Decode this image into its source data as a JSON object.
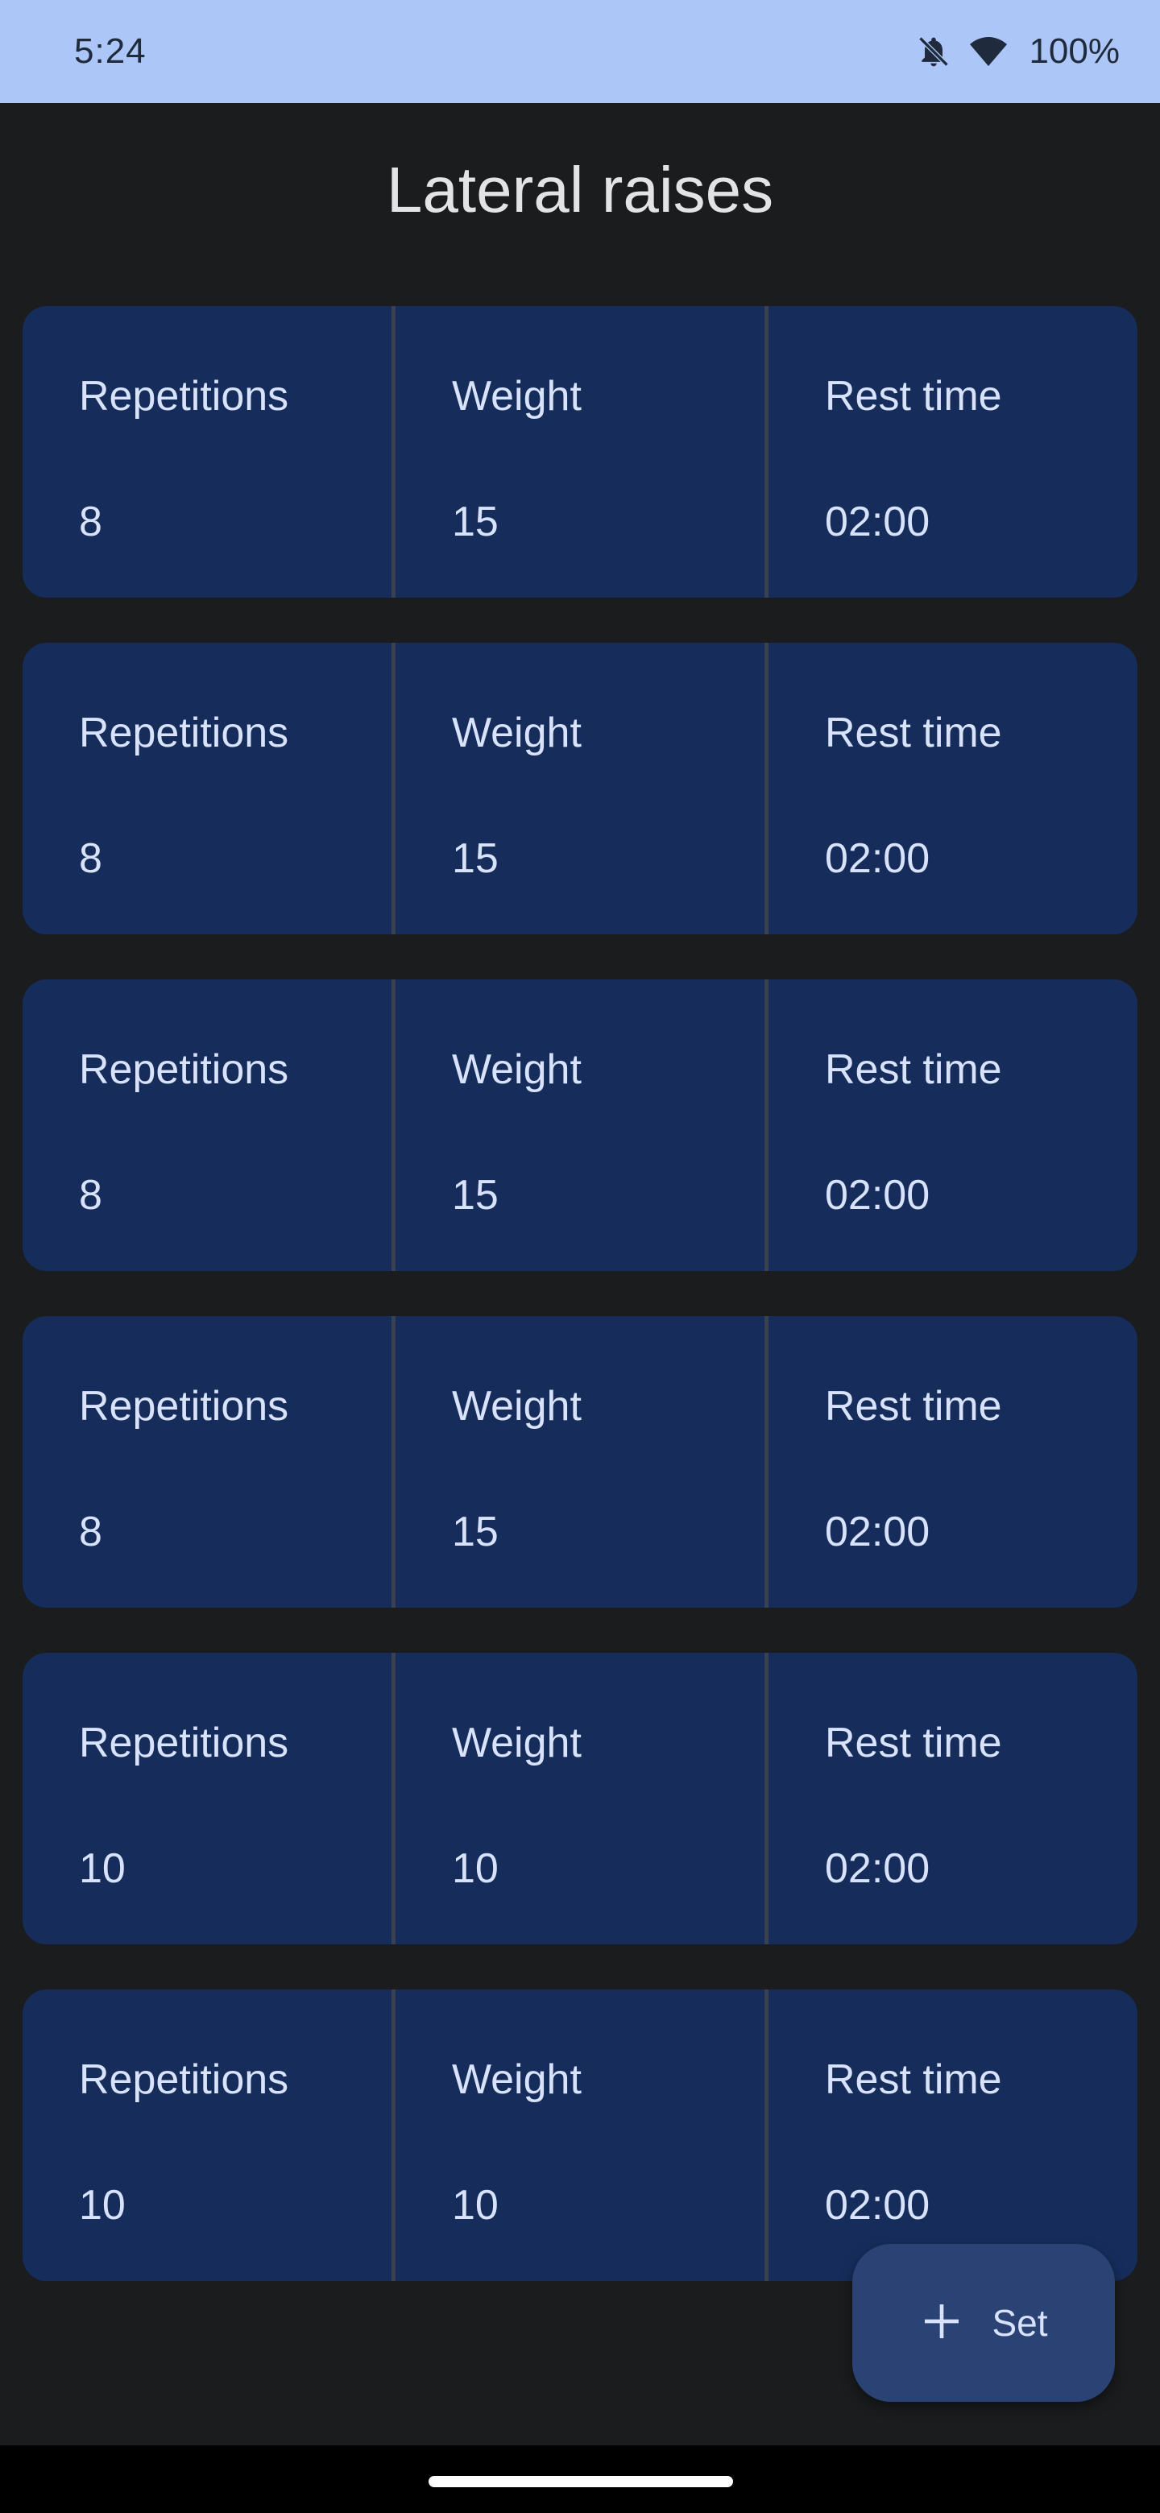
{
  "status_bar": {
    "time": "5:24",
    "battery": "100%",
    "icons": [
      "notifications-off-icon",
      "wifi-icon"
    ]
  },
  "screen": {
    "title": "Lateral raises"
  },
  "sets": [
    {
      "reps_label": "Repetitions",
      "reps": "8",
      "weight_label": "Weight",
      "weight": "15",
      "rest_label": "Rest time",
      "rest": "02:00"
    },
    {
      "reps_label": "Repetitions",
      "reps": "8",
      "weight_label": "Weight",
      "weight": "15",
      "rest_label": "Rest time",
      "rest": "02:00"
    },
    {
      "reps_label": "Repetitions",
      "reps": "8",
      "weight_label": "Weight",
      "weight": "15",
      "rest_label": "Rest time",
      "rest": "02:00"
    },
    {
      "reps_label": "Repetitions",
      "reps": "8",
      "weight_label": "Weight",
      "weight": "15",
      "rest_label": "Rest time",
      "rest": "02:00"
    },
    {
      "reps_label": "Repetitions",
      "reps": "10",
      "weight_label": "Weight",
      "weight": "10",
      "rest_label": "Rest time",
      "rest": "02:00"
    },
    {
      "reps_label": "Repetitions",
      "reps": "10",
      "weight_label": "Weight",
      "weight": "10",
      "rest_label": "Rest time",
      "rest": "02:00"
    }
  ],
  "fab": {
    "label": "Set",
    "icon": "plus-icon"
  },
  "colors": {
    "background": "#1b1c1e",
    "status_bar": "#adc6f8",
    "card": "#162d5c",
    "fab": "#2a4274",
    "text_on_card": "#d8e2fb"
  }
}
